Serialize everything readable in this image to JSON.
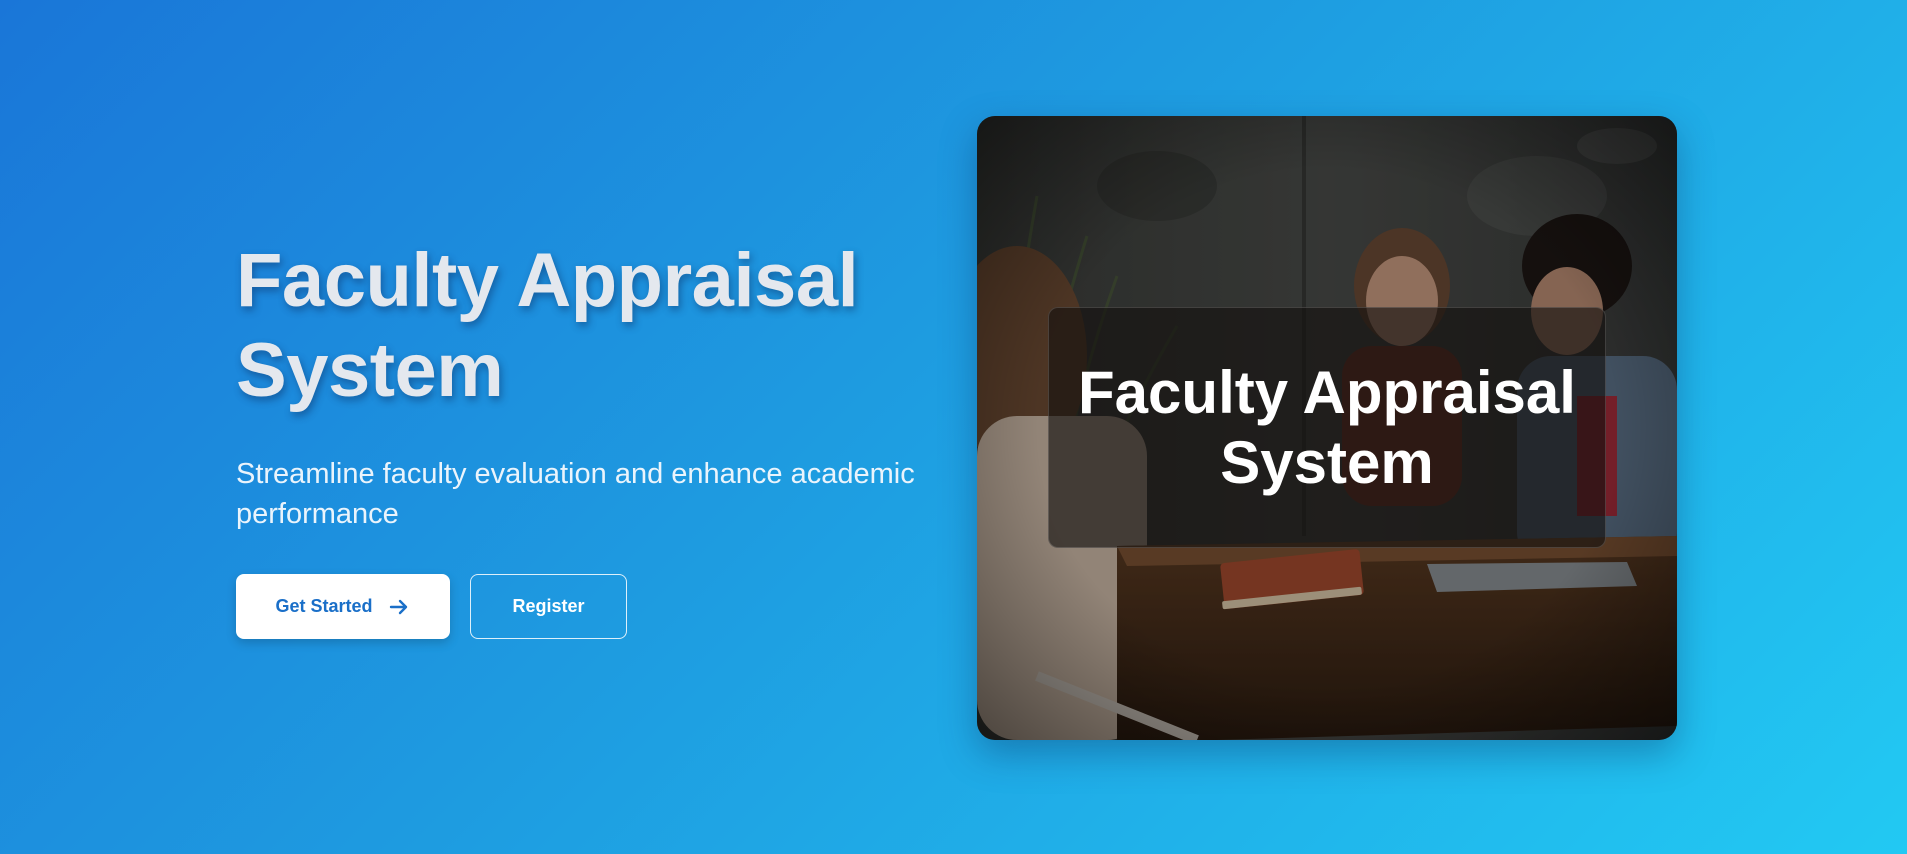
{
  "hero": {
    "title_line1": "Faculty Appraisal",
    "title_line2": "System",
    "subtitle_line1": "Streamline faculty evaluation and enhance academic",
    "subtitle_line2": "performance",
    "get_started_label": "Get Started",
    "register_label": "Register"
  },
  "card": {
    "title_line1": "Faculty Appraisal",
    "title_line2": "System",
    "image_subject": "people-meeting-at-table-photo"
  },
  "icons": {
    "get_started": "arrow-right-icon"
  },
  "colors": {
    "gradient_start": "#1a76d8",
    "gradient_end": "#22c9f3",
    "primary_button_text": "#1a6fc8"
  }
}
